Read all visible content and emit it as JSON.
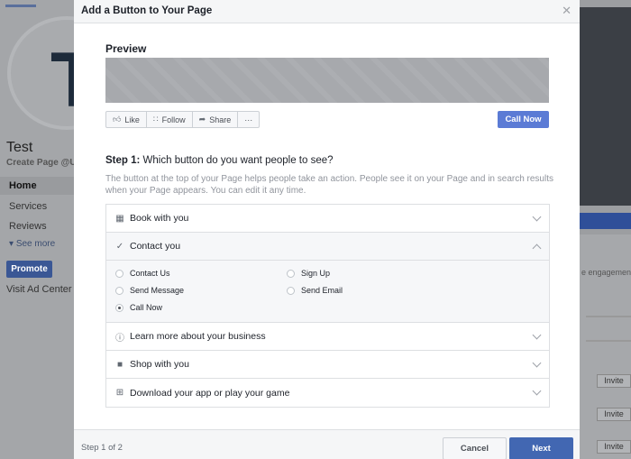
{
  "background": {
    "avatar_letter": "T",
    "page_name": "Test",
    "create_username": "Create Page @Username",
    "nav": [
      {
        "label": "Home"
      },
      {
        "label": "Services"
      },
      {
        "label": "Reviews"
      }
    ],
    "see_more": "See more",
    "promote": "Promote",
    "ad_center": "Visit Ad Center",
    "engagement": "e engagement",
    "invite": "Invite"
  },
  "modal": {
    "title": "Add a Button to Your Page",
    "close_icon": "close-icon",
    "preview_label": "Preview",
    "actionbar": [
      {
        "label": "Like",
        "icon": "thumbs-up-icon"
      },
      {
        "label": "Follow",
        "icon": "rss-icon"
      },
      {
        "label": "Share",
        "icon": "share-arrow-icon"
      },
      {
        "label": "···",
        "icon": "more-icon"
      }
    ],
    "preview_cta": "Call Now",
    "step_prefix": "Step 1:",
    "step_question": "Which button do you want people to see?",
    "description": "The button at the top of your Page helps people take an action. People see it on your Page and in search results when your Page appears. You can edit it any time.",
    "options": [
      {
        "label": "Book with you",
        "icon": "calendar-icon"
      },
      {
        "label": "Contact you",
        "icon": "checkmark-icon"
      },
      {
        "label": "Learn more about your business",
        "icon": "info-icon"
      },
      {
        "label": "Shop with you",
        "icon": "shopping-bag-icon"
      },
      {
        "label": "Download your app or play your game",
        "icon": "download-icon"
      }
    ],
    "contact_choices": [
      {
        "label": "Contact Us",
        "selected": false
      },
      {
        "label": "Sign Up",
        "selected": false
      },
      {
        "label": "Send Message",
        "selected": false
      },
      {
        "label": "Send Email",
        "selected": false
      },
      {
        "label": "Call Now",
        "selected": true
      }
    ],
    "footer": {
      "step_count": "Step 1 of 2",
      "cancel": "Cancel",
      "next": "Next"
    },
    "colors": {
      "primary": "#4267b2",
      "preview_cta": "#5b7bd5"
    }
  }
}
